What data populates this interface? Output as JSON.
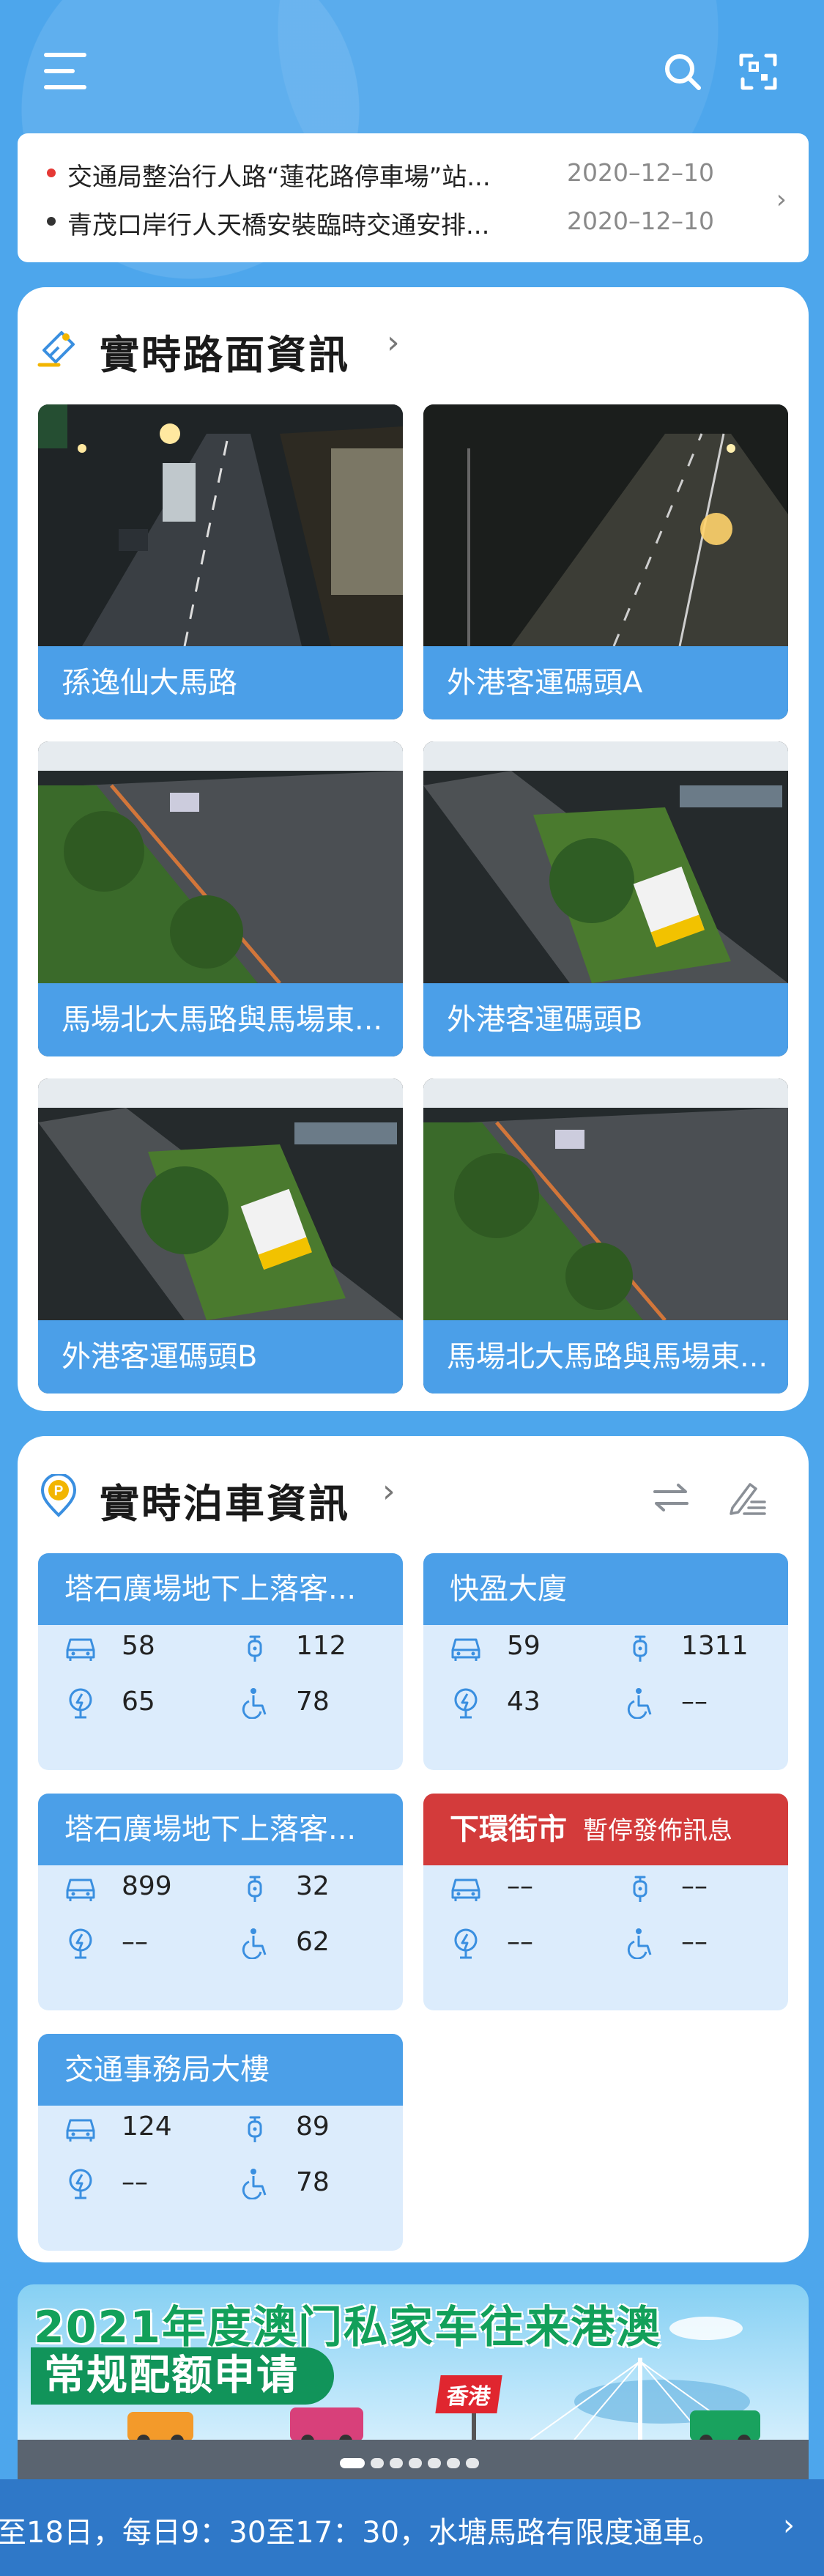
{
  "news": {
    "items": [
      {
        "title": "交通局整治行人路“蓮花路停車場”站...",
        "date": "2020–12–10",
        "dot_color": "#e53935"
      },
      {
        "title": "青茂口岸行人天橋安裝臨時交通安排...",
        "date": "2020–12–10",
        "dot_color": "#333333"
      }
    ],
    "arrow": "›"
  },
  "road": {
    "title": "實時路面資訊",
    "chevron": "›",
    "cameras": [
      {
        "name": "孫逸仙大馬路",
        "scene": "street"
      },
      {
        "name": "外港客運碼頭A",
        "scene": "road-night"
      },
      {
        "name": "馬場北大馬路與馬場東...",
        "scene": "flyover"
      },
      {
        "name": "外港客運碼頭B",
        "scene": "bus"
      },
      {
        "name": "外港客運碼頭B",
        "scene": "bus"
      },
      {
        "name": "馬場北大馬路與馬場東...",
        "scene": "flyover"
      }
    ]
  },
  "parking": {
    "title": "實時泊車資訊",
    "chevron": "›",
    "lots": [
      {
        "name": "塔石廣場地下上落客...",
        "car": "58",
        "moto": "112",
        "ev": "65",
        "disabled": "78"
      },
      {
        "name": "快盈大廈",
        "car": "59",
        "moto": "1311",
        "ev": "43",
        "disabled": "––"
      },
      {
        "name": "塔石廣場地下上落客...",
        "car": "899",
        "moto": "32",
        "ev": "––",
        "disabled": "62"
      },
      {
        "name": "下環街市",
        "status": "暫停發佈訊息",
        "car": "––",
        "moto": "––",
        "ev": "––",
        "disabled": "––"
      },
      {
        "name": "交通事務局大樓",
        "car": "124",
        "moto": "89",
        "ev": "––",
        "disabled": "78"
      }
    ]
  },
  "banner": {
    "title": "2021年度澳门私家车往来港澳",
    "subtitle": "常规配额申请",
    "sign": "香港",
    "slide_count": 7,
    "active_slide": 0
  },
  "ticker": {
    "text": "至18日，每日9：30至17：30，水塘馬路有限度通車。",
    "arrow": "›"
  },
  "colors": {
    "background": "#4da6ec",
    "accent": "#4b9fe8",
    "suspended": "#d33b3b",
    "lot_body": "#dcecfc",
    "ticker": "#2f78c8"
  },
  "icons": {
    "menu": "hamburger-icon",
    "search": "search-icon",
    "scan": "scan-icon",
    "road": "camera-icon",
    "parking": "parking-icon",
    "swap": "swap-icon",
    "edit": "edit-list-icon",
    "car": "car-icon",
    "moto": "motorcycle-icon",
    "ev": "ev-charging-icon",
    "disabled": "wheelchair-icon"
  }
}
